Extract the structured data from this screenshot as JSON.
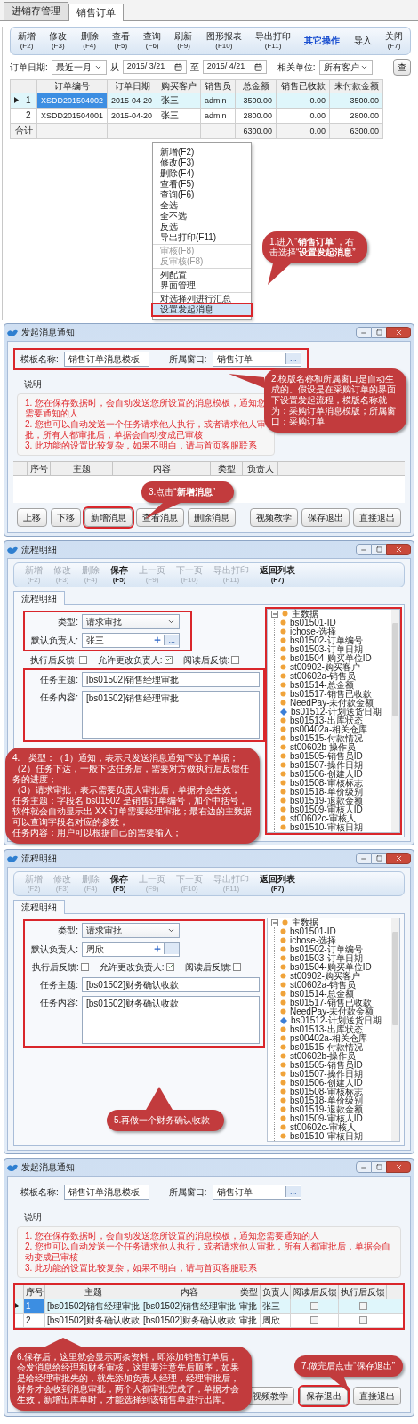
{
  "sales_order_screen": {
    "tabs": [
      {
        "label": "进销存管理",
        "selected": false
      },
      {
        "label": "销售订单",
        "selected": true
      }
    ],
    "toolbar": [
      {
        "kind": "button",
        "label": "新增",
        "key": "(F2)"
      },
      {
        "kind": "button",
        "label": "修改",
        "key": "(F3)"
      },
      {
        "kind": "button",
        "label": "删除",
        "key": "(F4)"
      },
      {
        "kind": "button",
        "label": "查看",
        "key": "(F5)"
      },
      {
        "kind": "button",
        "label": "查询",
        "key": "(F6)"
      },
      {
        "kind": "button",
        "label": "刷新",
        "key": "(F9)"
      },
      {
        "kind": "button",
        "label": "图形报表",
        "key": "(F10)"
      },
      {
        "kind": "button",
        "label": "导出打印",
        "key": "(F11)"
      },
      {
        "kind": "link",
        "label": "其它操作"
      },
      {
        "kind": "button",
        "label": "导入"
      },
      {
        "kind": "button",
        "label": "关闭",
        "key": "(F7)"
      }
    ],
    "filter": {
      "date_label": "订单日期:",
      "period": "最近一月",
      "from_label": "从",
      "from": "2015/ 3/21",
      "to_label": "至",
      "to": "2015/ 4/21",
      "unit_label": "相关单位:",
      "unit": "所有客户",
      "query_button": "查"
    },
    "table": {
      "columns": [
        "订单编号",
        "订单日期",
        "购买客户",
        "销售员",
        "总金额",
        "销售已收款",
        "未付款金额"
      ],
      "rows": [
        {
          "index": "1",
          "selected": true,
          "order_no": "XSDD201504002",
          "date": "2015-04-20",
          "customer": "张三",
          "seller": "admin",
          "total": "3500.00",
          "received": "0.00",
          "unpaid": "3500.00"
        },
        {
          "index": "2",
          "selected": false,
          "order_no": "XSDD201504001",
          "date": "2015-04-20",
          "customer": "张三",
          "seller": "admin",
          "total": "2800.00",
          "received": "0.00",
          "unpaid": "2800.00"
        }
      ],
      "summary": {
        "label": "合计",
        "total": "6300.00",
        "received": "0.00",
        "unpaid": "6300.00"
      }
    },
    "context_menu": [
      [
        {
          "label": "新增(F2)",
          "disabled": false,
          "selected": false
        },
        {
          "label": "修改(F3)",
          "disabled": false,
          "selected": false
        },
        {
          "label": "删除(F4)",
          "disabled": false,
          "selected": false
        },
        {
          "label": "查看(F5)",
          "disabled": false,
          "selected": false
        },
        {
          "label": "查询(F6)",
          "disabled": false,
          "selected": false
        },
        {
          "label": "全选",
          "disabled": false,
          "selected": false
        },
        {
          "label": "全不选",
          "disabled": false,
          "selected": false
        },
        {
          "label": "反选",
          "disabled": false,
          "selected": false
        },
        {
          "label": "导出打印(F11)",
          "disabled": false,
          "selected": false
        }
      ],
      [
        {
          "label": "审核(F8)",
          "disabled": true,
          "selected": false
        },
        {
          "label": "反审核(F8)",
          "disabled": true,
          "selected": false
        }
      ],
      [
        {
          "label": "列配置",
          "disabled": false,
          "selected": false
        },
        {
          "label": "界面管理",
          "disabled": false,
          "selected": false
        }
      ],
      [
        {
          "label": "对选择列进行汇总",
          "disabled": false,
          "selected": false
        },
        {
          "label": "设置发起消息",
          "disabled": false,
          "selected": true
        }
      ]
    ],
    "callout": "1.进入“**销售订单**”，右击选择“**设置发起消息**”"
  },
  "template_window": {
    "title": "发起消息通知",
    "template_label": "模板名称:",
    "template_name": "销售订单消息模板",
    "window_label": "所属窗口:",
    "window_name": "销售订单",
    "browse_button": "...",
    "fields_highlighted": true,
    "notes_title": "说明",
    "notes": [
      "1. 您在保存数据时，会自动发送您所设置的消息模板，通知您需要通知的人",
      "2. 您也可以自动发送一个任务请求他人执行，或者请求他人审批，所有人都审批后，单据会自动变成已审核",
      "3. 此功能的设置比较复杂，如果不明白，请与首页客服联系"
    ],
    "columns": [
      "序号",
      "主题",
      "内容",
      "类型",
      "负责人"
    ],
    "buttons": [
      {
        "label": "上移",
        "highlighted": false
      },
      {
        "label": "下移",
        "highlighted": false
      },
      {
        "label": "新增消息",
        "highlighted": true
      },
      {
        "label": "查看消息",
        "highlighted": false
      },
      {
        "label": "删除消息",
        "highlighted": false
      }
    ],
    "right_buttons": [
      {
        "label": "视频教学",
        "highlighted": false
      },
      {
        "label": "保存退出",
        "highlighted": false
      },
      {
        "label": "直接退出",
        "highlighted": false
      }
    ],
    "callouts": [
      "2.模版名称和所属窗口是自动生成的。假设是在采购订单的界面下设置发起流程，模版名称就为：采购订单消息模版；所属窗口：采购订单",
      "3.点击“**新增消息**”"
    ]
  },
  "approval_step_window": {
    "title": "流程明细",
    "toolbar": [
      {
        "label": "新增",
        "key": "(F2)",
        "disabled": true
      },
      {
        "label": "修改",
        "key": "(F3)",
        "disabled": true
      },
      {
        "label": "删除",
        "key": "(F4)",
        "disabled": true
      },
      {
        "label": "保存",
        "key": "(F5)",
        "disabled": false
      },
      {
        "label": "上一页",
        "key": "(F9)",
        "disabled": true
      },
      {
        "label": "下一页",
        "key": "(F10)",
        "disabled": true
      },
      {
        "label": "导出打印",
        "key": "(F11)",
        "disabled": true
      },
      {
        "label": "返回列表",
        "key": "(F7)",
        "disabled": false
      }
    ],
    "tab": "流程明细",
    "kind": "split_highlight",
    "type_label": "类型:",
    "type": "请求审批",
    "assignee_label": "默认负责人:",
    "assignee": "张三",
    "browse_button": "...",
    "checks": [
      {
        "label": "执行后反馈:",
        "checked": false
      },
      {
        "label": "允许更改负责人:",
        "checked": true
      },
      {
        "label": "阅读后反馈:",
        "checked": false
      }
    ],
    "subject_label": "任务主题:",
    "subject": "[bs01502]销售经理审批",
    "content_label": "任务内容:",
    "content": "[bs01502]销售经理审批",
    "tree_highlighted": true,
    "tree": {
      "label": "主数据",
      "expanded": true,
      "children": [
        {
          "label": "bs01501-ID",
          "kind": "field"
        },
        {
          "label": "ichose-选择",
          "kind": "field"
        },
        {
          "label": "bs01502-订单编号",
          "kind": "field"
        },
        {
          "label": "bs01503-订单日期",
          "kind": "field"
        },
        {
          "label": "bs01504-购买单位ID",
          "kind": "field"
        },
        {
          "label": "st00902-购买客户",
          "kind": "field"
        },
        {
          "label": "st00602a-销售员",
          "kind": "field"
        },
        {
          "label": "bs01514-总金额",
          "kind": "field"
        },
        {
          "label": "bs01517-销售已收款",
          "kind": "field"
        },
        {
          "label": "NeedPay-未付款金额",
          "kind": "field"
        },
        {
          "label": "bs01512-计划送货日期",
          "kind": "current"
        },
        {
          "label": "bs01513-出库状态",
          "kind": "field"
        },
        {
          "label": "ps00402a-相关仓库",
          "kind": "field"
        },
        {
          "label": "bs01515-付款情况",
          "kind": "field"
        },
        {
          "label": "st00602b-操作员",
          "kind": "field"
        },
        {
          "label": "bs01505-销售员ID",
          "kind": "field"
        },
        {
          "label": "bs01507-操作日期",
          "kind": "field"
        },
        {
          "label": "bs01506-创建人ID",
          "kind": "field"
        },
        {
          "label": "bs01508-审核标志",
          "kind": "field"
        },
        {
          "label": "bs01518-单价级别",
          "kind": "field"
        },
        {
          "label": "bs01519-退款金额",
          "kind": "field"
        },
        {
          "label": "bs01509-审核人ID",
          "kind": "field"
        },
        {
          "label": "st00602c-审核人",
          "kind": "field"
        },
        {
          "label": "bs01510-审核日期",
          "kind": "field"
        }
      ]
    },
    "callout_lines": [
      "4.　类型：（1）通知，表示只发送消息通知下达了单据；",
      "（2）任务下达，一般下达任务后，需要对方做执行后反馈任务的进度；",
      "（3）请求审批，表示需要负责人审批后，单据才会生效；",
      "任务主题：字段名 bs01502 是销售订单编号，加个中括号，软件就会自动显示出 XX 订单需要经理审批；最右边的主数据可以查询字段名对应的参数；",
      "任务内容：用户可以根据自己的需要输入；"
    ]
  },
  "finance_step_window": {
    "title": "流程明细",
    "toolbar": [
      {
        "label": "新增",
        "key": "(F2)",
        "disabled": true
      },
      {
        "label": "修改",
        "key": "(F3)",
        "disabled": true
      },
      {
        "label": "删除",
        "key": "(F4)",
        "disabled": true
      },
      {
        "label": "保存",
        "key": "(F5)",
        "disabled": false
      },
      {
        "label": "上一页",
        "key": "(F9)",
        "disabled": true
      },
      {
        "label": "下一页",
        "key": "(F10)",
        "disabled": true
      },
      {
        "label": "导出打印",
        "key": "(F11)",
        "disabled": true
      },
      {
        "label": "返回列表",
        "key": "(F7)",
        "disabled": false
      }
    ],
    "tab": "流程明细",
    "kind": "whole_highlight",
    "type_label": "类型:",
    "type": "请求审批",
    "assignee_label": "默认负责人:",
    "assignee": "周欣",
    "browse_button": "...",
    "checks": [
      {
        "label": "执行后反馈:",
        "checked": false
      },
      {
        "label": "允许更改负责人:",
        "checked": true
      },
      {
        "label": "阅读后反馈:",
        "checked": false
      }
    ],
    "subject_label": "任务主题:",
    "subject": "[bs01502]财务确认收款",
    "content_label": "任务内容:",
    "content": "[bs01502]财务确认收款",
    "tree_highlighted": false,
    "tree": {
      "label": "主数据",
      "expanded": true,
      "children": [
        {
          "label": "bs01501-ID",
          "kind": "field"
        },
        {
          "label": "ichose-选择",
          "kind": "field"
        },
        {
          "label": "bs01502-订单编号",
          "kind": "field"
        },
        {
          "label": "bs01503-订单日期",
          "kind": "field"
        },
        {
          "label": "bs01504-购买单位ID",
          "kind": "field"
        },
        {
          "label": "st00902-购买客户",
          "kind": "field"
        },
        {
          "label": "st00602a-销售员",
          "kind": "field"
        },
        {
          "label": "bs01514-总金额",
          "kind": "field"
        },
        {
          "label": "bs01517-销售已收款",
          "kind": "field"
        },
        {
          "label": "NeedPay-未付款金额",
          "kind": "field"
        },
        {
          "label": "bs01512-计划送货日期",
          "kind": "current"
        },
        {
          "label": "bs01513-出库状态",
          "kind": "field"
        },
        {
          "label": "ps00402a-相关仓库",
          "kind": "field"
        },
        {
          "label": "bs01515-付款情况",
          "kind": "field"
        },
        {
          "label": "st00602b-操作员",
          "kind": "field"
        },
        {
          "label": "bs01505-销售员ID",
          "kind": "field"
        },
        {
          "label": "bs01507-操作日期",
          "kind": "field"
        },
        {
          "label": "bs01506-创建人ID",
          "kind": "field"
        },
        {
          "label": "bs01508-审核标志",
          "kind": "field"
        },
        {
          "label": "bs01518-单价级别",
          "kind": "field"
        },
        {
          "label": "bs01519-退款金额",
          "kind": "field"
        },
        {
          "label": "bs01509-审核人ID",
          "kind": "field"
        },
        {
          "label": "st00602c-审核人",
          "kind": "field"
        },
        {
          "label": "bs01510-审核日期",
          "kind": "field"
        }
      ]
    },
    "callout_lines": [
      "5.再做一个财务确认收款"
    ]
  },
  "saved_template_window": {
    "title": "发起消息通知",
    "template_label": "模板名称:",
    "template_name": "销售订单消息模板",
    "window_label": "所属窗口:",
    "window_name": "销售订单",
    "browse_button": "...",
    "fields_highlighted": false,
    "notes_title": "说明",
    "notes": [
      "1. 您在保存数据时，会自动发送您所设置的消息模板，通知您需要通知的人",
      "2. 您也可以自动发送一个任务请求他人执行，或者请求他人审批，所有人都审批后，单据会自动变成已审核",
      "3. 此功能的设置比较复杂，如果不明白，请与首页客服联系"
    ],
    "columns": [
      "序号",
      "主题",
      "内容",
      "类型",
      "负责人",
      "阅读后反馈",
      "执行后反馈"
    ],
    "table_highlighted": true,
    "rows": [
      {
        "index": "1",
        "selected": true,
        "subject": "[bs01502]销售经理审批",
        "content": "[bs01502]销售经理审批",
        "type": "审批",
        "assignee": "张三",
        "read_feedback": false,
        "exec_feedback": false
      },
      {
        "index": "2",
        "selected": false,
        "subject": "[bs01502]财务确认收款",
        "content": "[bs01502]财务确认收款",
        "type": "审批",
        "assignee": "周欣",
        "read_feedback": false,
        "exec_feedback": false
      }
    ],
    "right_buttons": [
      {
        "label": "视频教学",
        "highlighted": false
      },
      {
        "label": "保存退出",
        "highlighted": true
      },
      {
        "label": "直接退出",
        "highlighted": false
      }
    ],
    "callouts": [
      "6.保存后，这里就会显示两条资料，即添加销售订单后，会发消息给经理和财务审核，这里要注意先后顺序，如果是给经理审批先的，就先添加负责人经理，经理审批后，财务才会收到消息审批，两个人都审批完成了，单据才会生效，新增出库单时，才能选择到该销售单进行出库。",
      "7.做完后点击“保存退出”"
    ]
  }
}
